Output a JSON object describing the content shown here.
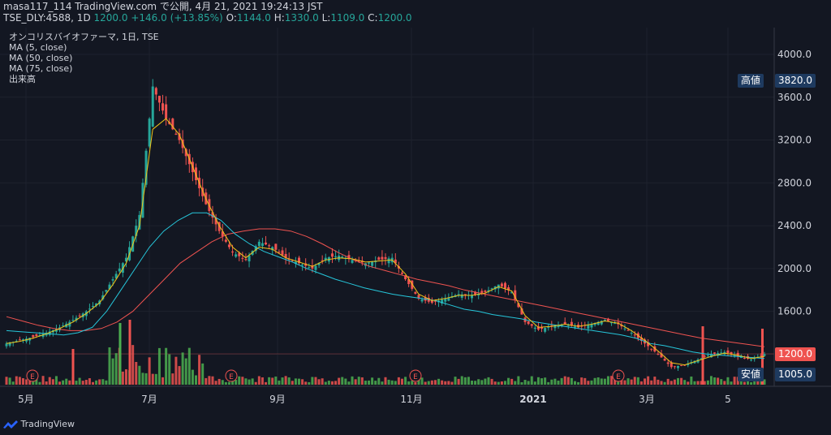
{
  "header": {
    "line1": "masa117_114 TradingView.com で公開, 4月 21, 2021 19:24:13 JST",
    "symbol": "TSE_DLY:4588, 1D",
    "price": "1200.0",
    "change": "+146.0 (+13.85%)",
    "o_label": "O:",
    "o_value": "1144.0",
    "h_label": "H:",
    "h_value": "1330.0",
    "l_label": "L:",
    "l_value": "1109.0",
    "c_label": "C:",
    "c_value": "1200.0"
  },
  "legend": {
    "title": "オンコリスバイオファーマ, 1日, TSE",
    "ma5": "MA (5, close)",
    "ma50": "MA (50, close)",
    "ma75": "MA (75, close)",
    "volume": "出来高"
  },
  "price_labels": {
    "high_label": "高値",
    "high_value": "3820.0",
    "last_value": "1200.0",
    "low_label": "安値",
    "low_value": "1005.0"
  },
  "branding": "TradingView",
  "colors": {
    "background": "#131722",
    "up": "#26a69a",
    "down": "#ef5350",
    "ma5": "#f0c419",
    "ma50": "#26c6da",
    "ma75": "#ef5350",
    "vol_up": "#4caf50",
    "vol_down": "#ef5350"
  },
  "chart_data": {
    "type": "candlestick",
    "y_ticks": [
      "1200.0",
      "1600.0",
      "2000.0",
      "2400.0",
      "2800.0",
      "3200.0",
      "3600.0",
      "4000.0"
    ],
    "x_ticks": [
      "5月",
      "7月",
      "9月",
      "11月",
      "2021",
      "3月",
      "5"
    ],
    "ylim": [
      900,
      4250
    ],
    "event_markers": [
      "E",
      "E",
      "E",
      "E"
    ],
    "close_series": [
      1300,
      1330,
      1360,
      1400,
      1450,
      1520,
      1600,
      1700,
      1900,
      2100,
      2500,
      3700,
      3400,
      3200,
      2900,
      2600,
      2350,
      2150,
      2080,
      2250,
      2200,
      2100,
      2050,
      2000,
      2100,
      2120,
      2080,
      2050,
      2080,
      2100,
      1900,
      1720,
      1680,
      1720,
      1760,
      1750,
      1780,
      1850,
      1780,
      1500,
      1430,
      1460,
      1480,
      1450,
      1480,
      1520,
      1480,
      1400,
      1300,
      1200,
      1080,
      1100,
      1150,
      1200,
      1220,
      1180,
      1150,
      1200
    ],
    "ma5": [
      1300,
      1320,
      1350,
      1390,
      1440,
      1500,
      1580,
      1680,
      1850,
      2050,
      2400,
      3300,
      3400,
      3250,
      2950,
      2650,
      2400,
      2200,
      2100,
      2200,
      2180,
      2100,
      2060,
      2020,
      2080,
      2100,
      2090,
      2060,
      2070,
      2080,
      1950,
      1760,
      1700,
      1720,
      1750,
      1750,
      1770,
      1830,
      1790,
      1560,
      1450,
      1460,
      1480,
      1460,
      1480,
      1510,
      1490,
      1420,
      1330,
      1230,
      1120,
      1100,
      1140,
      1180,
      1210,
      1190,
      1160,
      1180
    ],
    "ma50": [
      1420,
      1410,
      1400,
      1390,
      1380,
      1400,
      1450,
      1600,
      1800,
      2000,
      2200,
      2350,
      2450,
      2520,
      2520,
      2450,
      2320,
      2230,
      2160,
      2110,
      2060,
      2000,
      1950,
      1900,
      1860,
      1820,
      1790,
      1760,
      1740,
      1720,
      1700,
      1660,
      1620,
      1600,
      1570,
      1550,
      1530,
      1500,
      1480,
      1460,
      1440,
      1420,
      1400,
      1380,
      1350,
      1300,
      1280,
      1250,
      1220,
      1200,
      1190,
      1180,
      1170,
      1160
    ],
    "ma75": [
      1550,
      1510,
      1470,
      1440,
      1420,
      1420,
      1440,
      1500,
      1600,
      1750,
      1900,
      2050,
      2150,
      2250,
      2320,
      2350,
      2370,
      2370,
      2350,
      2300,
      2230,
      2150,
      2080,
      2020,
      1980,
      1940,
      1900,
      1870,
      1840,
      1800,
      1770,
      1740,
      1710,
      1680,
      1650,
      1620,
      1590,
      1560,
      1530,
      1500,
      1470,
      1440,
      1410,
      1380,
      1350,
      1330,
      1310,
      1290,
      1270
    ],
    "volume_spikes": [
      {
        "v": 0.55,
        "up": false
      },
      {
        "v": 0.95,
        "up": true
      },
      {
        "v": 1.0,
        "up": false
      },
      {
        "v": 0.9,
        "up": false
      }
    ]
  }
}
